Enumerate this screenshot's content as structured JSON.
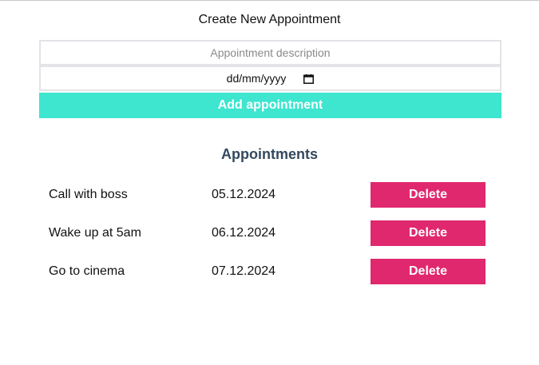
{
  "form": {
    "title": "Create New Appointment",
    "description_placeholder": "Appointment description",
    "date_placeholder": "dd/mm/yyyy",
    "add_label": "Add appointment"
  },
  "list": {
    "title": "Appointments",
    "delete_label": "Delete",
    "items": [
      {
        "description": "Call with boss",
        "date": "05.12.2024"
      },
      {
        "description": "Wake up at 5am",
        "date": "06.12.2024"
      },
      {
        "description": "Go to cinema",
        "date": "07.12.2024"
      }
    ]
  },
  "icons": {
    "date_picker": "calendar-icon"
  },
  "colors": {
    "add_button": "#3ee5cf",
    "delete_button": "#e0286e",
    "list_title": "#34495e"
  }
}
